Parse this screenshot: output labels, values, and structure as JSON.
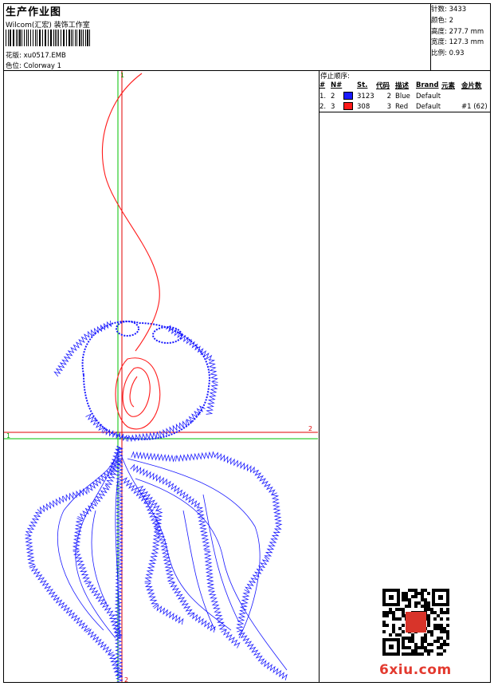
{
  "header": {
    "title": "生产作业图",
    "subtitle": "Wilcom(汇宏) 装饰工作室",
    "design_label": "花版:",
    "design_value": "xu0517.EMB",
    "colorway_label": "色位:",
    "colorway_value": "Colorway 1"
  },
  "stats": [
    {
      "label": "针数:",
      "value": "3433"
    },
    {
      "label": "颜色:",
      "value": "2"
    },
    {
      "label": "高度:",
      "value": "277.7 mm"
    },
    {
      "label": "宽度:",
      "value": "127.3 mm"
    },
    {
      "label": "比例:",
      "value": "0.93"
    }
  ],
  "stop_sequence": {
    "title": "停止顺序:",
    "headers": [
      "#",
      "N#",
      "",
      "St.",
      "代码",
      "描述",
      "Brand",
      "元素",
      "金片数"
    ],
    "rows": [
      {
        "num": "1.",
        "n": "2",
        "color": "#1a1aff",
        "stitches": "3123",
        "code": "2",
        "desc": "Blue",
        "brand": "Default",
        "element": "",
        "sequins": ""
      },
      {
        "num": "2.",
        "n": "3",
        "color": "#ff1a1a",
        "stitches": "308",
        "code": "3",
        "desc": "Red",
        "brand": "Default",
        "element": "",
        "sequins": "#1 (62)"
      }
    ]
  },
  "guides": {
    "h_start": "1",
    "h_end": "2",
    "v_start": "1",
    "v_end": "2"
  },
  "colors": {
    "blue_thread": "#1a1aff",
    "red_thread": "#ff1a1a",
    "guide_green": "#00c000",
    "guide_red": "#e00000"
  },
  "watermark": "6xiu.com"
}
